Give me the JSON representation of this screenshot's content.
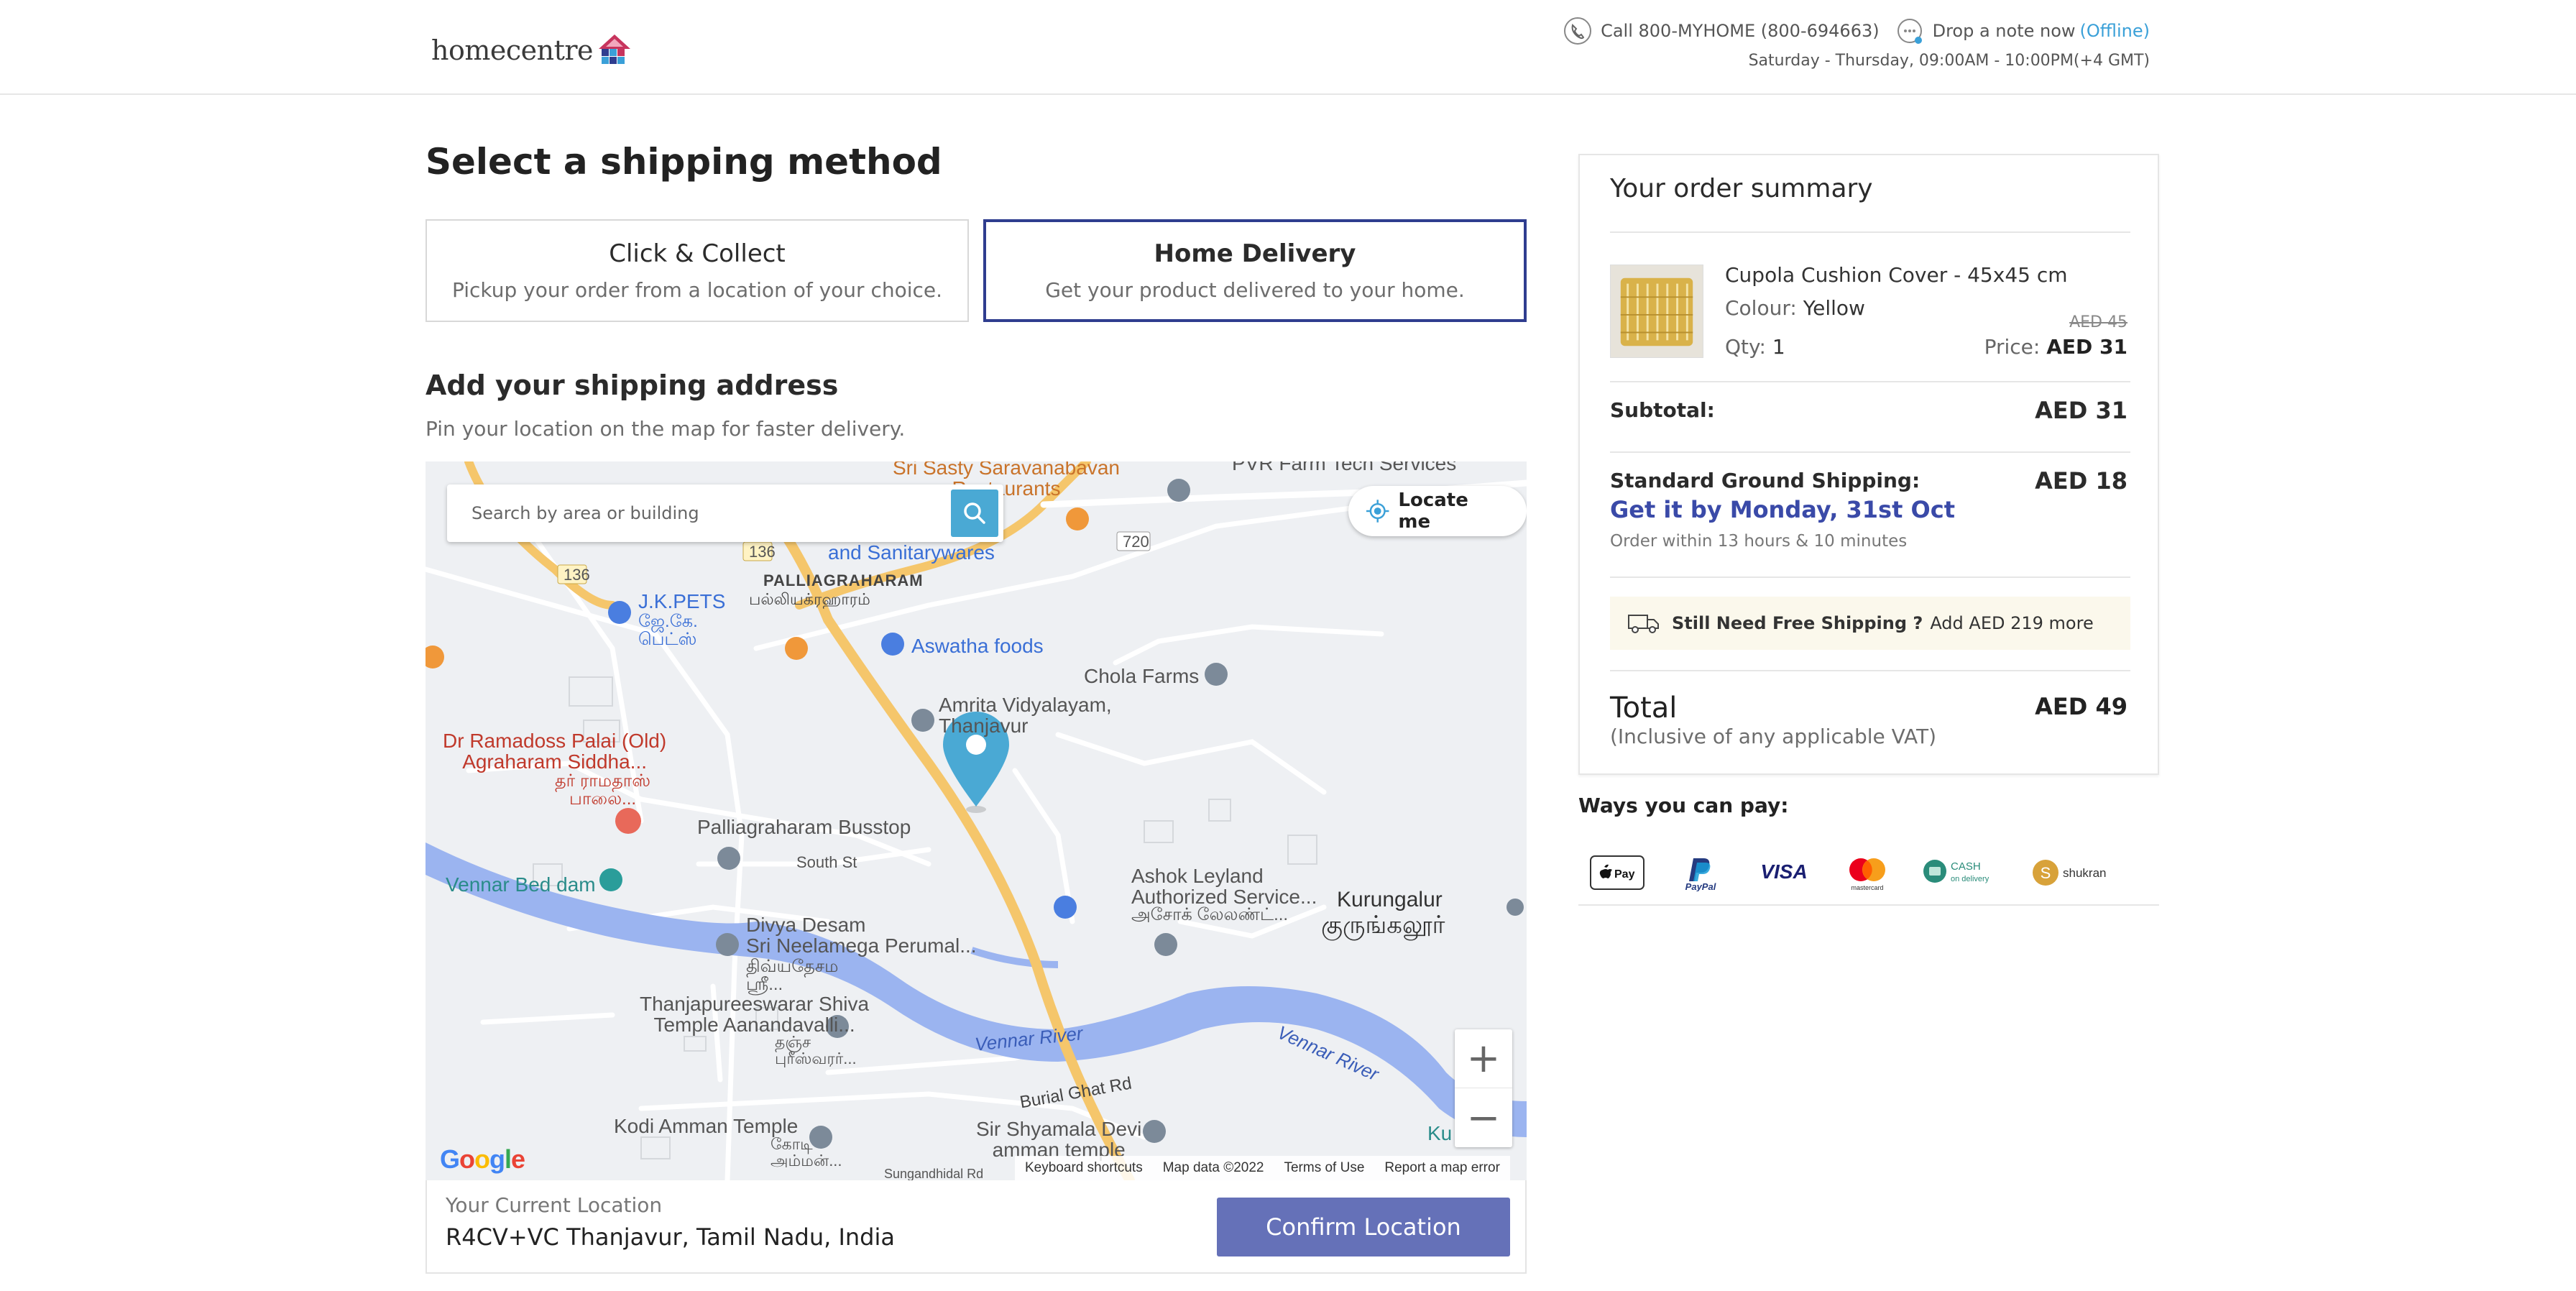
{
  "header": {
    "logo_text": "homecentre",
    "phone": "Call 800-MYHOME (800-694663)",
    "note": "Drop a note now",
    "note_status": "(Offline)",
    "hours": "Saturday - Thursday, 09:00AM - 10:00PM(+4 GMT)"
  },
  "page_title": "Select a shipping method",
  "methods": [
    {
      "title": "Click & Collect",
      "subtitle": "Pickup your order from a location of your choice.",
      "selected": false
    },
    {
      "title": "Home Delivery",
      "subtitle": "Get your product delivered to your home.",
      "selected": true
    }
  ],
  "address": {
    "title": "Add your shipping address",
    "subtitle": "Pin your location on the map for faster delivery."
  },
  "map": {
    "search_placeholder": "Search by area or building",
    "locate_label": "Locate me",
    "labels": {
      "sri_sasty": "Sri Sasty Saravanabavan\nRestaurants",
      "pvr": "PVR Farm Tech Services",
      "sanitary": "and Sanitarywares",
      "palliagraharam": "PALLIAGRAHARAM",
      "palliagraharam_ta": "பல்லியக்ரஹாரம்",
      "jkpets": "J.K.PETS",
      "jkpets_ta": "ஜே.கே.\nபெட்ஸ்",
      "aswatha": "Aswatha foods",
      "chola": "Chola Farms",
      "amrita": "Amrita Vidyalayam,\nThanjavur",
      "ramadoss": "Dr Ramadoss Palai (Old)\nAgraharam Siddha...",
      "ramadoss_ta": "தர் ராமதாஸ்\nபாலை...",
      "busstop": "Palliagraharam Busstop",
      "south_st": "South St",
      "vennar_bed": "Vennar Bed dam",
      "divya": "Divya Desam\nSri Neelamega Perumal...",
      "divya_ta": "திவ்யதேசம\nஸ்ரீ...",
      "ashok": "Ashok Leyland\nAuthorized Service...",
      "ashok_ta": "அசோக் லேலண்ட்...",
      "kurungalur": "Kurungalur",
      "kurungalur_ta": "குருங்கலூர்",
      "thanjapuree": "Thanjapureeswarar Shiva\nTemple Aanandavalli...",
      "thanjapuree_ta": "தஞ்ச\nபுரீஸ்வரர்...",
      "vennar_river_1": "Vennar River",
      "vennar_river_2": "Vennar River",
      "burial": "Burial Ghat Rd",
      "kodi": "Kodi Amman Temple",
      "kodi_ta": "கோடி\nஅம்மன்...",
      "shyamala": "Sir Shyamala Devi\namman temple",
      "sungandhi": "Sungandhidal Rd",
      "road_136a": "136",
      "road_136b": "136",
      "road_720": "720",
      "ku_edge": "Ku"
    },
    "google": "Google",
    "attribution": [
      "Keyboard shortcuts",
      "Map data ©2022",
      "Terms of Use",
      "Report a map error"
    ]
  },
  "location": {
    "label": "Your Current Location",
    "value": "R4CV+VC Thanjavur, Tamil Nadu, India",
    "confirm": "Confirm Location"
  },
  "summary": {
    "title": "Your order summary",
    "product": {
      "name": "Cupola Cushion Cover - 45x45 cm",
      "colour_label": "Colour:",
      "colour": "Yellow",
      "qty_label": "Qty:",
      "qty": "1",
      "old_price": "AED 45",
      "price_label": "Price:",
      "price": "AED 31"
    },
    "subtotal_label": "Subtotal:",
    "subtotal": "AED 31",
    "shipping_label": "Standard Ground Shipping:",
    "shipping": "AED 18",
    "eta": "Get it by Monday, 31st Oct",
    "order_within": "Order within 13 hours & 10 minutes",
    "free_shipping_q": "Still Need Free Shipping ?",
    "free_shipping_more": "Add AED 219 more",
    "total_label": "Total",
    "vat": "(Inclusive of any applicable VAT)",
    "total": "AED 49"
  },
  "payments": {
    "title": "Ways you can pay:",
    "methods": [
      "Apple Pay",
      "PayPal",
      "VISA",
      "mastercard",
      "CASH on delivery",
      "shukran"
    ],
    "applepay_text": "Pay",
    "paypal_text": "PayPal",
    "visa_text": "VISA",
    "mastercard_text": "mastercard",
    "cash_text": "CASH",
    "cash_sub": "on delivery",
    "shukran_text": "shukran"
  },
  "colors": {
    "selected_border": "#2f3d8f",
    "confirm_button": "#6571b8",
    "accent_blue": "#3aa0d8",
    "eta": "#3a4aa8",
    "pin": "#4aa9d4"
  }
}
